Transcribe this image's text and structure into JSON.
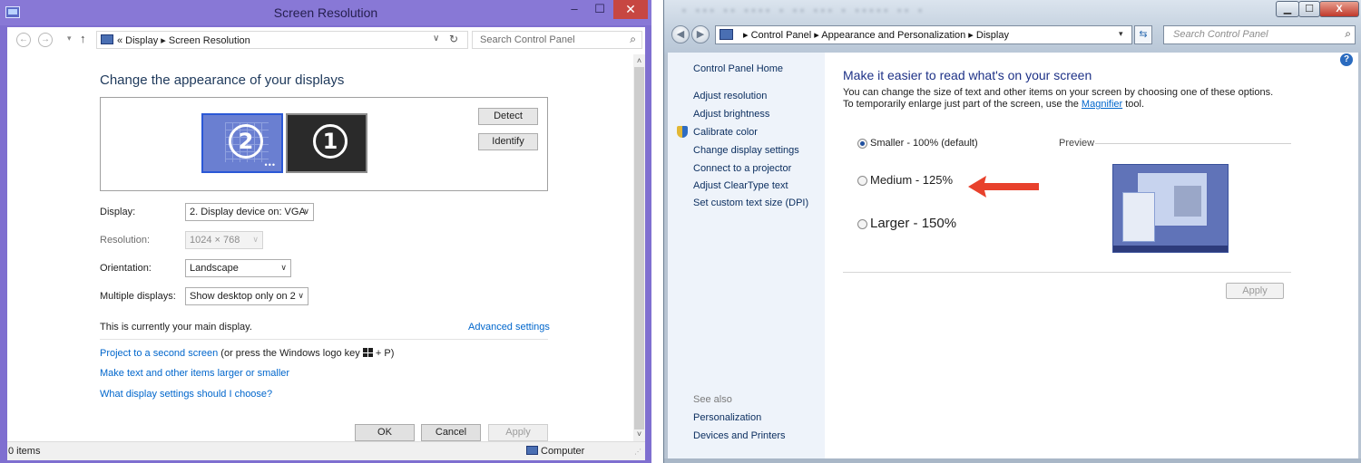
{
  "left_window": {
    "title": "Screen Resolution",
    "controls": {
      "minimize": "–",
      "maximize": "☐",
      "close": "✕"
    },
    "nav": {
      "back": "←",
      "forward": "→",
      "recent": "▾",
      "up": "↑"
    },
    "address": {
      "crumbs": "« Display ▸ Screen Resolution",
      "dropdown": "∨",
      "refresh": "↻"
    },
    "search": {
      "placeholder": "Search Control Panel",
      "icon": "⌕"
    },
    "heading": "Change the appearance of your displays",
    "monitors": [
      {
        "number": "2",
        "selected": true
      },
      {
        "number": "1",
        "selected": false
      }
    ],
    "detect_label": "Detect",
    "identify_label": "Identify",
    "fields": {
      "display": {
        "label": "Display:",
        "value": "2. Display device on: VGA"
      },
      "resolution": {
        "label": "Resolution:",
        "value": "1024 × 768"
      },
      "orientation": {
        "label": "Orientation:",
        "value": "Landscape"
      },
      "multiple": {
        "label": "Multiple displays:",
        "value": "Show desktop only on 2"
      }
    },
    "main_display_msg": "This is currently your main display.",
    "advanced_settings": "Advanced settings",
    "links": {
      "project": "Project to a second screen",
      "project_suffix_a": " (or press the Windows logo key ",
      "project_suffix_b": " + P)",
      "text_size": "Make text and other items larger or smaller",
      "help": "What display settings should I choose?"
    },
    "buttons": {
      "ok": "OK",
      "cancel": "Cancel",
      "apply": "Apply"
    },
    "status": {
      "items": "0 items",
      "computer": "Computer"
    },
    "scroll": {
      "up": "˄",
      "down": "˅"
    }
  },
  "right_window": {
    "controls": {
      "minimize": "▁",
      "maximize": "☐",
      "close": "X"
    },
    "nav": {
      "back": "◀",
      "forward": "▶"
    },
    "address": {
      "crumbs": "▸ Control Panel ▸ Appearance and Personalization ▸ Display",
      "dropdown": "▾"
    },
    "refresh": "⇆",
    "search": {
      "placeholder": "Search Control Panel",
      "icon": "⌕"
    },
    "sidebar": {
      "home": "Control Panel Home",
      "items": [
        "Adjust resolution",
        "Adjust brightness",
        "Calibrate color",
        "Change display settings",
        "Connect to a projector",
        "Adjust ClearType text",
        "Set custom text size (DPI)"
      ],
      "see_also": "See also",
      "see_also_items": [
        "Personalization",
        "Devices and Printers"
      ]
    },
    "help": "?",
    "heading": "Make it easier to read what's on your screen",
    "description_a": "You can change the size of text and other items on your screen by choosing one of these options. To temporarily enlarge just part of the screen, use the ",
    "magnifier": "Magnifier",
    "description_b": " tool.",
    "options": [
      {
        "label": "Smaller - 100% (default)",
        "selected": true
      },
      {
        "label": "Medium - 125%",
        "selected": false
      },
      {
        "label": "Larger - 150%",
        "selected": false
      }
    ],
    "preview_label": "Preview",
    "apply": "Apply",
    "colors": {
      "arrow": "#e8412c",
      "link": "#0066cc",
      "heading": "#1e3287"
    }
  }
}
